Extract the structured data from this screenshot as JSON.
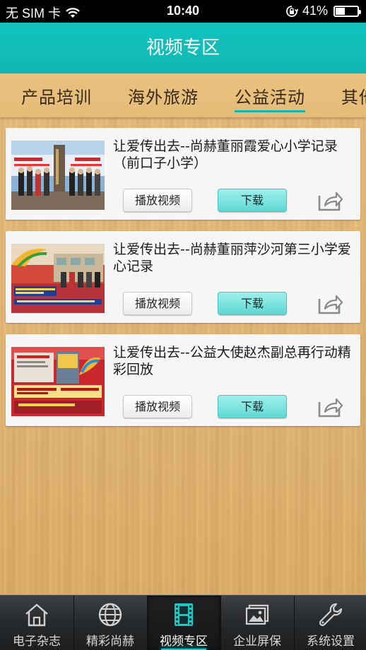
{
  "status_bar": {
    "carrier": "无 SIM 卡",
    "time": "10:40",
    "battery_percent": "41%",
    "battery_level": 0.41,
    "icons": [
      "wifi-icon",
      "orientation-lock-icon",
      "battery-icon"
    ]
  },
  "header": {
    "title": "视频专区"
  },
  "tabs": [
    {
      "label": "产品培训"
    },
    {
      "label": "海外旅游"
    },
    {
      "label": "公益活动",
      "active": true
    },
    {
      "label": "其他"
    }
  ],
  "videos": [
    {
      "title": "让爱传出去--尚赫董丽霞爱心小学记录（前口子小学）",
      "play_label": "播放视频",
      "download_label": "下载"
    },
    {
      "title": "让爱传出去--尚赫董丽萍沙河第三小学爱心记录",
      "play_label": "播放视频",
      "download_label": "下载"
    },
    {
      "title": "让爱传出去--公益大使赵杰副总再行动精彩回放",
      "play_label": "播放视频",
      "download_label": "下载"
    }
  ],
  "bottom_nav": [
    {
      "label": "电子杂志",
      "icon": "home-icon"
    },
    {
      "label": "精彩尚赫",
      "icon": "globe-icon"
    },
    {
      "label": "视频专区",
      "icon": "film-icon",
      "active": true
    },
    {
      "label": "企业屏保",
      "icon": "picture-icon"
    },
    {
      "label": "系统设置",
      "icon": "wrench-icon"
    }
  ],
  "colors": {
    "accent": "#12bfbb",
    "wood": "#e3b878",
    "nav_bg": "#2a2d30"
  }
}
